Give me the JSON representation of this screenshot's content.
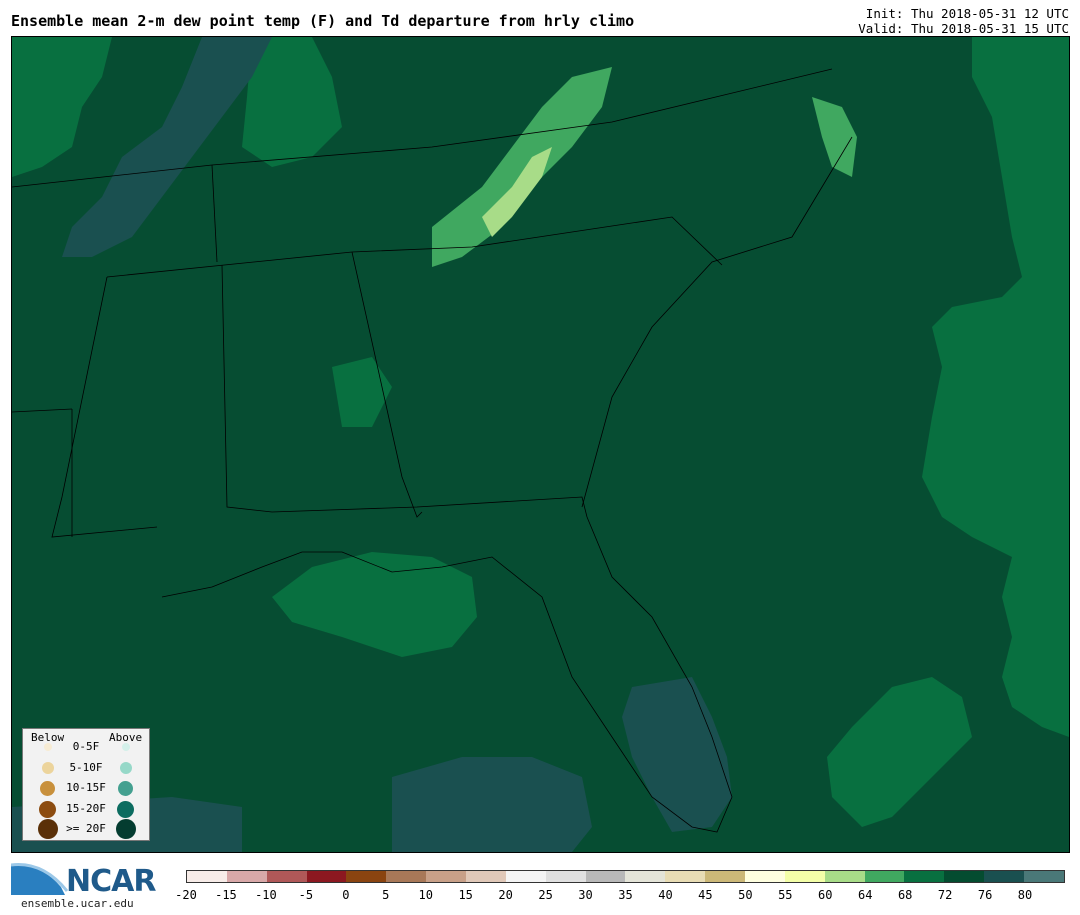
{
  "header": {
    "title": "Ensemble mean 2-m dew point temp (F) and Td departure from hrly climo",
    "init": "Init: Thu 2018-05-31 12 UTC",
    "valid": "Valid: Thu 2018-05-31 15 UTC"
  },
  "legend": {
    "below_label": "Below",
    "above_label": "Above",
    "rows": [
      {
        "label": "0-5F",
        "below_color": "#f7ecd4",
        "above_color": "#d4f0ea"
      },
      {
        "label": "5-10F",
        "below_color": "#ecd49c",
        "above_color": "#96d8c8"
      },
      {
        "label": "10-15F",
        "below_color": "#c8903c",
        "above_color": "#44a090"
      },
      {
        "label": "15-20F",
        "below_color": "#8c4c10",
        "above_color": "#0c6c60"
      },
      {
        "label": ">= 20F",
        "below_color": "#5a3008",
        "above_color": "#043c30"
      }
    ]
  },
  "colorbar": {
    "colors": [
      "#f7ece8",
      "#d8a8a8",
      "#b05858",
      "#8c1820",
      "#8a4410",
      "#a87858",
      "#c8a088",
      "#e0c8b8",
      "#f4f4f4",
      "#e0e0e0",
      "#b8b8b8",
      "#e4e4d8",
      "#e8dcb4",
      "#ccb878",
      "#ffffe0",
      "#f4ffa8",
      "#a8dc88",
      "#40a860",
      "#087040",
      "#044c30",
      "#1a5050",
      "#4a7878"
    ],
    "ticks": [
      "-20",
      "-15",
      "-10",
      "-5",
      "0",
      "5",
      "10",
      "15",
      "20",
      "25",
      "30",
      "35",
      "40",
      "45",
      "50",
      "55",
      "60",
      "64",
      "68",
      "72",
      "76",
      "80"
    ]
  },
  "logo": {
    "text": "NCAR",
    "url": "ensemble.ucar.edu"
  },
  "map_colors": {
    "base": "#064d32",
    "gulf_band": "#087040",
    "teal": "#1a5050",
    "light_green": "#40a860",
    "pale_green": "#a8dc88"
  }
}
